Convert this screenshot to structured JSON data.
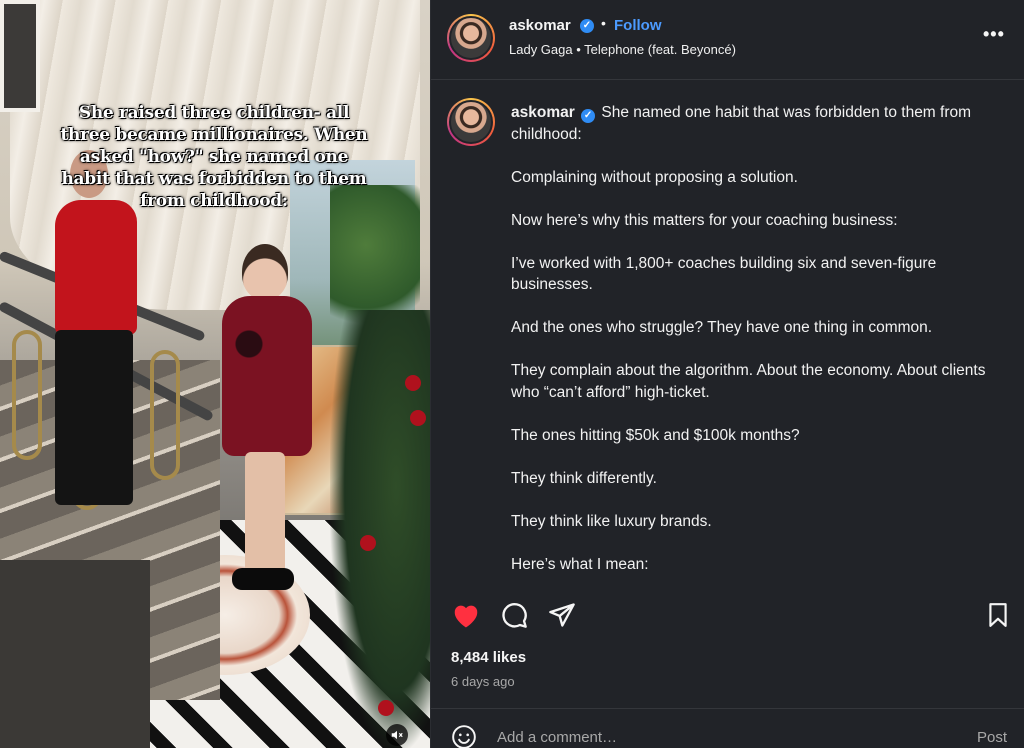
{
  "media": {
    "overlay_text": "She raised three children- all three became millionaires. When asked \"how?\" she named one habit that was forbidden to them from childhood:",
    "mute_icon": "speaker-muted-icon"
  },
  "header": {
    "username": "askomar",
    "verified_mark": "✓",
    "separator": "•",
    "follow_label": "Follow",
    "audio": "Lady Gaga • Telephone (feat. Beyoncé)",
    "more_label": "•••"
  },
  "caption": {
    "username": "askomar",
    "verified_mark": "✓",
    "paragraphs": [
      "She named one habit that was forbidden to them from childhood:",
      "Complaining without proposing a solution.",
      "Now here’s why this matters for your coaching business:",
      "I’ve worked with 1,800+ coaches building six and seven-figure businesses.",
      "And the ones who struggle? They have one thing in common.",
      "They complain about the algorithm. About the economy. About clients who “can’t afford” high-ticket.",
      "The ones hitting $50k and $100k months?",
      "They think differently.",
      "They think like luxury brands.",
      "Here’s what I mean:"
    ]
  },
  "actions": {
    "like_icon": "heart-filled-icon",
    "comment_icon": "comment-bubble-icon",
    "share_icon": "paper-plane-icon",
    "save_icon": "bookmark-icon",
    "like_color": "#ff3040"
  },
  "stats": {
    "likes": "8,484 likes",
    "time_ago": "6 days ago"
  },
  "comment": {
    "placeholder": "Add a comment…",
    "post_label": "Post",
    "emoji_icon": "smiley-icon"
  }
}
